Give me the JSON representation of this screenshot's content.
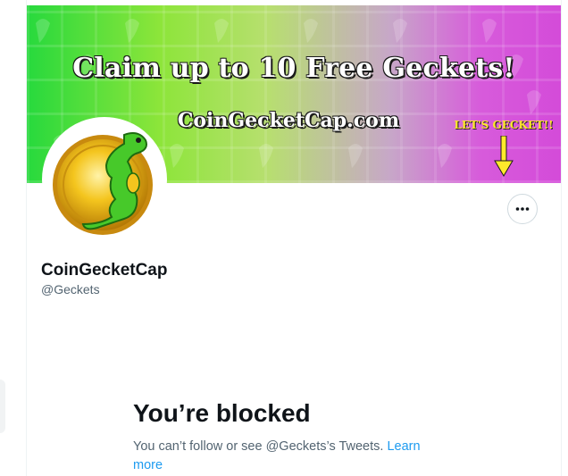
{
  "banner": {
    "headline": "Claim up to 10 Free Geckets!",
    "site": "CoinGecketCap.com",
    "cta": "LET'S GECKET!!"
  },
  "profile": {
    "display_name": "CoinGecketCap",
    "handle": "@Geckets"
  },
  "more_button": {
    "icon": "more-horizontal-icon"
  },
  "blocked": {
    "title": "You’re blocked",
    "message": "You can’t follow or see @Geckets’s Tweets.",
    "link_label": "Learn more"
  },
  "colors": {
    "link": "#1d9bf0",
    "secondary_text": "#536471",
    "primary_text": "#0f1419",
    "banner_cta": "#ffe92b"
  }
}
